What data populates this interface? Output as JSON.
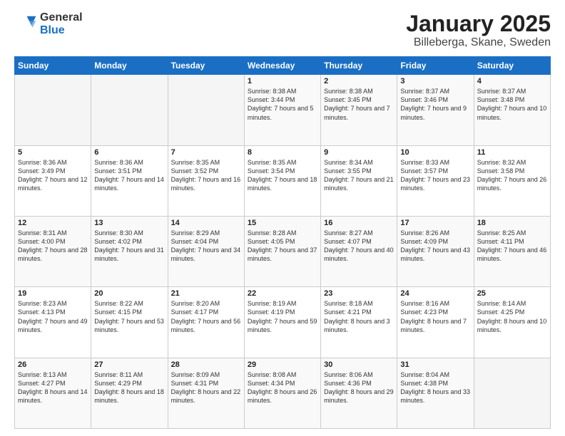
{
  "header": {
    "logo_general": "General",
    "logo_blue": "Blue",
    "title": "January 2025",
    "subtitle": "Billeberga, Skane, Sweden"
  },
  "days_of_week": [
    "Sunday",
    "Monday",
    "Tuesday",
    "Wednesday",
    "Thursday",
    "Friday",
    "Saturday"
  ],
  "weeks": [
    [
      {
        "day": "",
        "info": ""
      },
      {
        "day": "",
        "info": ""
      },
      {
        "day": "",
        "info": ""
      },
      {
        "day": "1",
        "info": "Sunrise: 8:38 AM\nSunset: 3:44 PM\nDaylight: 7 hours\nand 5 minutes."
      },
      {
        "day": "2",
        "info": "Sunrise: 8:38 AM\nSunset: 3:45 PM\nDaylight: 7 hours\nand 7 minutes."
      },
      {
        "day": "3",
        "info": "Sunrise: 8:37 AM\nSunset: 3:46 PM\nDaylight: 7 hours\nand 9 minutes."
      },
      {
        "day": "4",
        "info": "Sunrise: 8:37 AM\nSunset: 3:48 PM\nDaylight: 7 hours\nand 10 minutes."
      }
    ],
    [
      {
        "day": "5",
        "info": "Sunrise: 8:36 AM\nSunset: 3:49 PM\nDaylight: 7 hours\nand 12 minutes."
      },
      {
        "day": "6",
        "info": "Sunrise: 8:36 AM\nSunset: 3:51 PM\nDaylight: 7 hours\nand 14 minutes."
      },
      {
        "day": "7",
        "info": "Sunrise: 8:35 AM\nSunset: 3:52 PM\nDaylight: 7 hours\nand 16 minutes."
      },
      {
        "day": "8",
        "info": "Sunrise: 8:35 AM\nSunset: 3:54 PM\nDaylight: 7 hours\nand 18 minutes."
      },
      {
        "day": "9",
        "info": "Sunrise: 8:34 AM\nSunset: 3:55 PM\nDaylight: 7 hours\nand 21 minutes."
      },
      {
        "day": "10",
        "info": "Sunrise: 8:33 AM\nSunset: 3:57 PM\nDaylight: 7 hours\nand 23 minutes."
      },
      {
        "day": "11",
        "info": "Sunrise: 8:32 AM\nSunset: 3:58 PM\nDaylight: 7 hours\nand 26 minutes."
      }
    ],
    [
      {
        "day": "12",
        "info": "Sunrise: 8:31 AM\nSunset: 4:00 PM\nDaylight: 7 hours\nand 28 minutes."
      },
      {
        "day": "13",
        "info": "Sunrise: 8:30 AM\nSunset: 4:02 PM\nDaylight: 7 hours\nand 31 minutes."
      },
      {
        "day": "14",
        "info": "Sunrise: 8:29 AM\nSunset: 4:04 PM\nDaylight: 7 hours\nand 34 minutes."
      },
      {
        "day": "15",
        "info": "Sunrise: 8:28 AM\nSunset: 4:05 PM\nDaylight: 7 hours\nand 37 minutes."
      },
      {
        "day": "16",
        "info": "Sunrise: 8:27 AM\nSunset: 4:07 PM\nDaylight: 7 hours\nand 40 minutes."
      },
      {
        "day": "17",
        "info": "Sunrise: 8:26 AM\nSunset: 4:09 PM\nDaylight: 7 hours\nand 43 minutes."
      },
      {
        "day": "18",
        "info": "Sunrise: 8:25 AM\nSunset: 4:11 PM\nDaylight: 7 hours\nand 46 minutes."
      }
    ],
    [
      {
        "day": "19",
        "info": "Sunrise: 8:23 AM\nSunset: 4:13 PM\nDaylight: 7 hours\nand 49 minutes."
      },
      {
        "day": "20",
        "info": "Sunrise: 8:22 AM\nSunset: 4:15 PM\nDaylight: 7 hours\nand 53 minutes."
      },
      {
        "day": "21",
        "info": "Sunrise: 8:20 AM\nSunset: 4:17 PM\nDaylight: 7 hours\nand 56 minutes."
      },
      {
        "day": "22",
        "info": "Sunrise: 8:19 AM\nSunset: 4:19 PM\nDaylight: 7 hours\nand 59 minutes."
      },
      {
        "day": "23",
        "info": "Sunrise: 8:18 AM\nSunset: 4:21 PM\nDaylight: 8 hours\nand 3 minutes."
      },
      {
        "day": "24",
        "info": "Sunrise: 8:16 AM\nSunset: 4:23 PM\nDaylight: 8 hours\nand 7 minutes."
      },
      {
        "day": "25",
        "info": "Sunrise: 8:14 AM\nSunset: 4:25 PM\nDaylight: 8 hours\nand 10 minutes."
      }
    ],
    [
      {
        "day": "26",
        "info": "Sunrise: 8:13 AM\nSunset: 4:27 PM\nDaylight: 8 hours\nand 14 minutes."
      },
      {
        "day": "27",
        "info": "Sunrise: 8:11 AM\nSunset: 4:29 PM\nDaylight: 8 hours\nand 18 minutes."
      },
      {
        "day": "28",
        "info": "Sunrise: 8:09 AM\nSunset: 4:31 PM\nDaylight: 8 hours\nand 22 minutes."
      },
      {
        "day": "29",
        "info": "Sunrise: 8:08 AM\nSunset: 4:34 PM\nDaylight: 8 hours\nand 26 minutes."
      },
      {
        "day": "30",
        "info": "Sunrise: 8:06 AM\nSunset: 4:36 PM\nDaylight: 8 hours\nand 29 minutes."
      },
      {
        "day": "31",
        "info": "Sunrise: 8:04 AM\nSunset: 4:38 PM\nDaylight: 8 hours\nand 33 minutes."
      },
      {
        "day": "",
        "info": ""
      }
    ]
  ]
}
